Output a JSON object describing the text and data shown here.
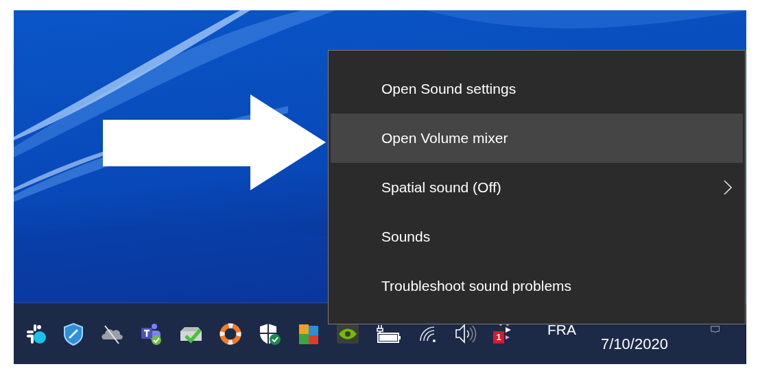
{
  "context_menu": {
    "items": [
      {
        "label": "Open Sound settings",
        "kind": "action",
        "selected": false
      },
      {
        "label": "Open Volume mixer",
        "kind": "action",
        "selected": true
      },
      {
        "label": "Spatial sound (Off)",
        "kind": "submenu",
        "selected": false
      },
      {
        "label": "Sounds",
        "kind": "action",
        "selected": false
      },
      {
        "label": "Troubleshoot sound problems",
        "kind": "action",
        "selected": false
      }
    ]
  },
  "taskbar": {
    "notification_badge": "1",
    "language": "FRA",
    "date": "7/10/2020"
  }
}
